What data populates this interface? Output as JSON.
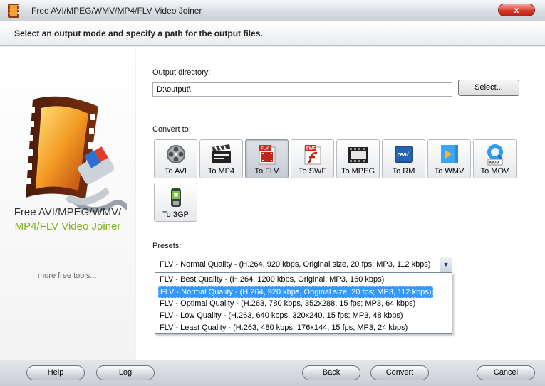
{
  "window": {
    "title": "Free AVI/MPEG/WMV/MP4/FLV Video Joiner",
    "close_label": "x"
  },
  "header": {
    "instruction": "Select an output mode and specify a path for the output files."
  },
  "sidebar": {
    "brand_line1": "Free AVI/MPEG/WMV/",
    "brand_line2": "MP4/FLV Video Joiner",
    "more_tools": "more free tools..."
  },
  "output": {
    "label": "Output directory:",
    "path": "D:\\output\\",
    "select_label": "Select..."
  },
  "convert": {
    "label": "Convert to:",
    "formats": [
      {
        "label": "To AVI",
        "icon": "film-reel-icon",
        "active": false
      },
      {
        "label": "To MP4",
        "icon": "clapperboard-icon",
        "active": false
      },
      {
        "label": "To FLV",
        "icon": "flv-file-icon",
        "active": true
      },
      {
        "label": "To SWF",
        "icon": "swf-flash-icon",
        "active": false
      },
      {
        "label": "To MPEG",
        "icon": "mpeg-film-icon",
        "active": false
      },
      {
        "label": "To RM",
        "icon": "real-media-icon",
        "active": false
      },
      {
        "label": "To WMV",
        "icon": "windows-media-icon",
        "active": false
      },
      {
        "label": "To MOV",
        "icon": "quicktime-icon",
        "active": false
      },
      {
        "label": "To 3GP",
        "icon": "mobile-3gp-icon",
        "active": false
      }
    ]
  },
  "presets": {
    "label": "Presets:",
    "selected": "FLV - Normal Quality - (H.264, 920 kbps, Original size, 20 fps; MP3, 112 kbps)",
    "options": [
      "FLV - Best Quality - (H.264, 1200 kbps, Original; MP3, 160 kbps)",
      "FLV - Normal Quality - (H.264, 920 kbps, Original size, 20 fps; MP3, 112 kbps)",
      "FLV - Optimal Quality - (H.263, 780 kbps, 352x288, 15 fps; MP3, 64 kbps)",
      "FLV - Low Quality - (H.263, 640 kbps, 320x240, 15 fps; MP3, 48 kbps)",
      "FLV - Least Quality - (H.263, 480 kbps, 176x144, 15 fps; MP3, 24 kbps)"
    ],
    "highlighted_index": 1
  },
  "footer": {
    "help": "Help",
    "log": "Log",
    "back": "Back",
    "convert": "Convert",
    "cancel": "Cancel"
  }
}
